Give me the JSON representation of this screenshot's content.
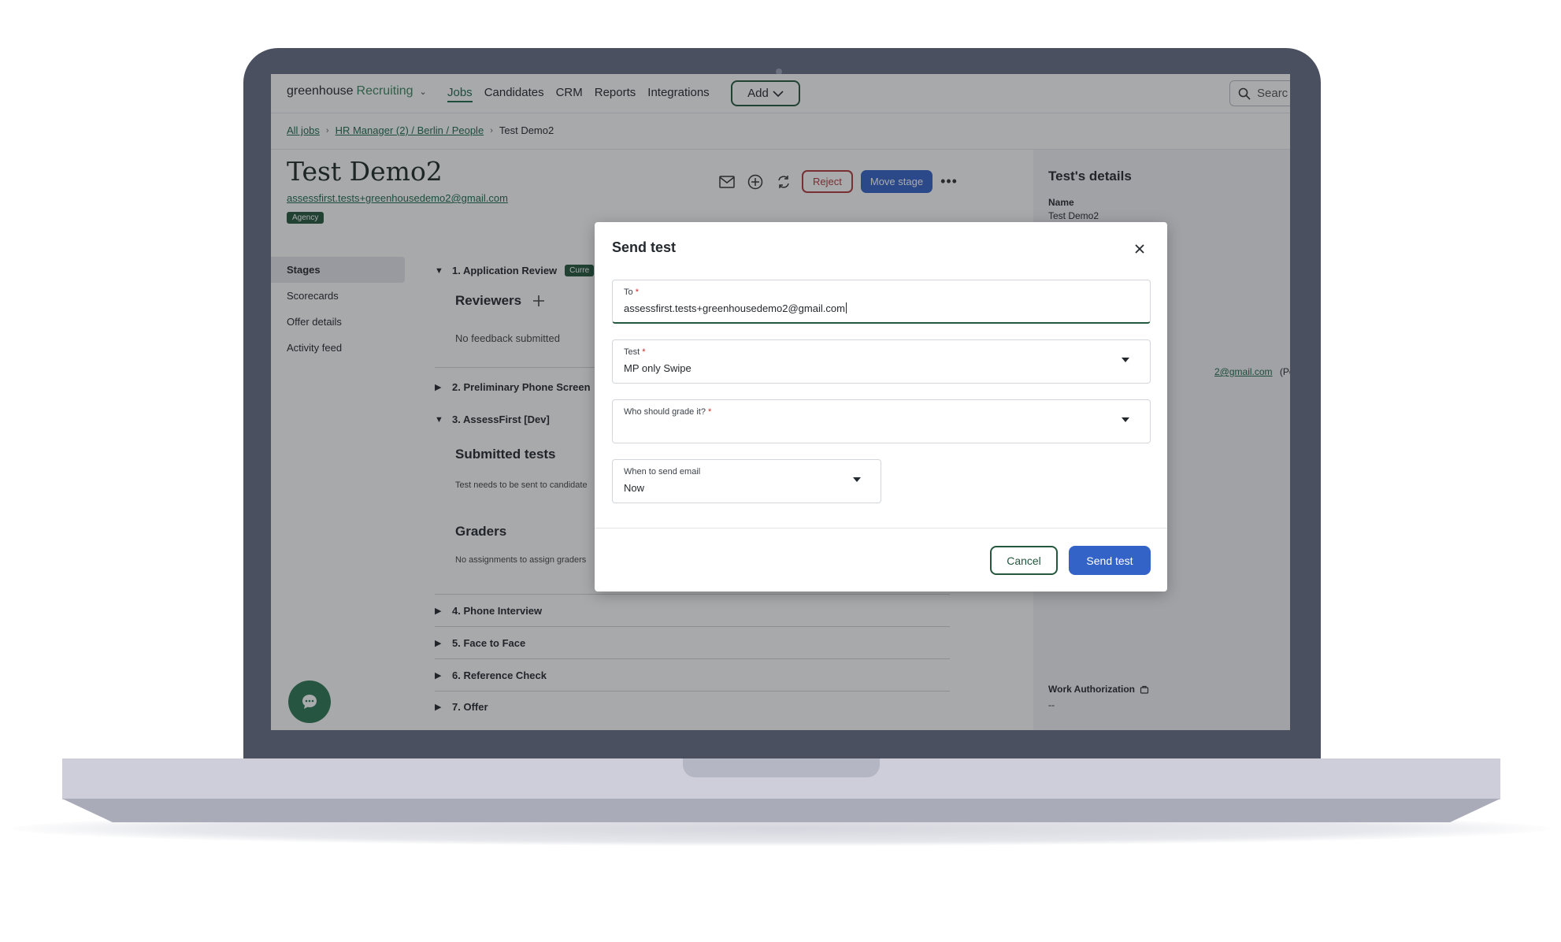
{
  "header": {
    "logo_primary": "greenhouse",
    "logo_secondary": "Recruiting",
    "nav": [
      "Jobs",
      "Candidates",
      "CRM",
      "Reports",
      "Integrations"
    ],
    "add_label": "Add",
    "search_placeholder": "Searc"
  },
  "breadcrumb": {
    "all_jobs": "All jobs",
    "job": "HR Manager (2) / Berlin / People",
    "current": "Test Demo2"
  },
  "candidate": {
    "name": "Test Demo2",
    "email": "assessfirst.tests+greenhousedemo2@gmail.com",
    "badge": "Agency"
  },
  "actions": {
    "reject": "Reject",
    "move_stage": "Move stage",
    "more": "•••"
  },
  "sidebar": {
    "items": [
      "Stages",
      "Scorecards",
      "Offer details",
      "Activity feed"
    ]
  },
  "stages": {
    "s1_title": "1. Application Review",
    "s1_badge": "Curre",
    "reviewers": "Reviewers",
    "no_feedback": "No feedback submitted",
    "s2_title": "2. Preliminary Phone Screen",
    "s3_title": "3. AssessFirst [Dev]",
    "submitted_tests": "Submitted tests",
    "submitted_note": "Test needs to be sent to candidate",
    "graders": "Graders",
    "graders_note": "No assignments to assign graders",
    "s4_title": "4. Phone Interview",
    "s5_title": "5. Face to Face",
    "s6_title": "6. Reference Check",
    "s7_title": "7. Offer"
  },
  "details": {
    "title": "Test's details",
    "name_label": "Name",
    "name_value": "Test Demo2",
    "email_fragment": "2@gmail.com",
    "email_type": "(Personal)",
    "work_auth_label": "Work Authorization",
    "work_auth_value": "--"
  },
  "modal": {
    "title": "Send test",
    "to_label": "To",
    "to_value": "assessfirst.tests+greenhousedemo2@gmail.com",
    "test_label": "Test",
    "test_value": "MP only Swipe",
    "grader_label": "Who should grade it?",
    "grader_value": "",
    "when_label": "When to send email",
    "when_value": "Now",
    "required_mark": "*",
    "cancel": "Cancel",
    "send": "Send test"
  },
  "colors": {
    "brand_green": "#24573d",
    "primary_blue": "#3463c7",
    "reject_red": "#b13a3a",
    "laptop_body": "#4b5060"
  }
}
